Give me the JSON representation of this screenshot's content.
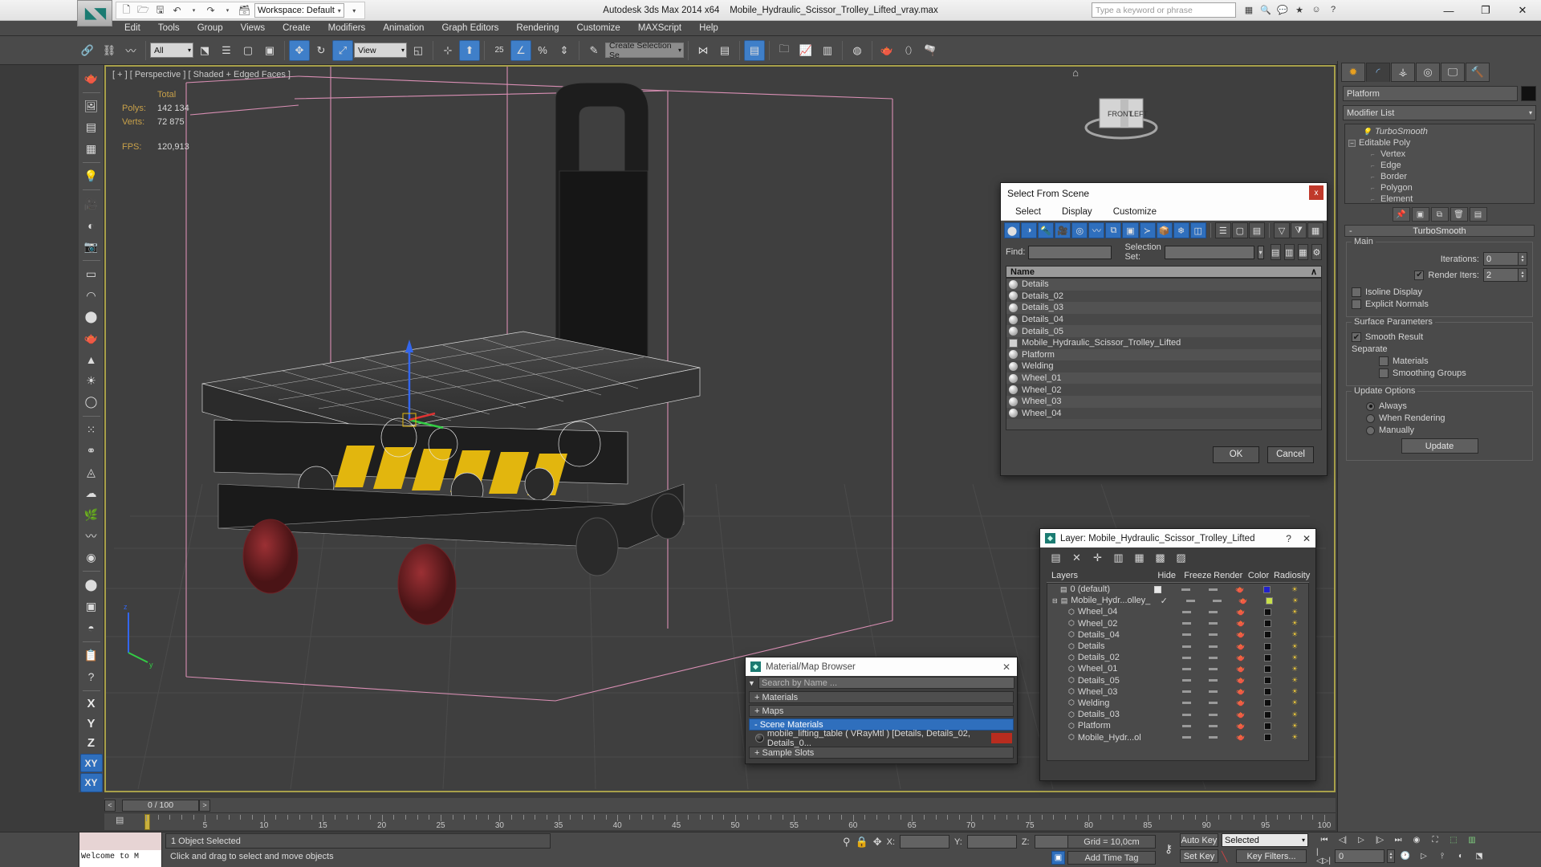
{
  "app": {
    "title_product": "Autodesk 3ds Max  2014 x64",
    "title_file": "Mobile_Hydraulic_Scissor_Trolley_Lifted_vray.max",
    "workspace_label": "Workspace: Default",
    "search_placeholder": "Type a keyword or phrase",
    "logo_glyph": "◆"
  },
  "menu": {
    "items": [
      "Edit",
      "Tools",
      "Group",
      "Views",
      "Create",
      "Modifiers",
      "Animation",
      "Graph Editors",
      "Rendering",
      "Customize",
      "MAXScript",
      "Help"
    ]
  },
  "quick_access": {
    "icons": [
      "new-file-icon",
      "open-file-icon",
      "save-icon",
      "undo-icon",
      "redo-icon",
      "set-project-icon"
    ]
  },
  "toolbar": {
    "selection_filter": "All",
    "reference_coord": "View",
    "named_selection_set": "Create Selection Se",
    "angle_snap_value": "25",
    "icons": [
      "select-link-icon",
      "unlink-icon",
      "bind-space-warp-icon",
      "select-object-icon",
      "select-by-name-icon",
      "rect-select-region-icon",
      "window-crossing-icon",
      "select-move-icon",
      "select-rotate-icon",
      "select-scale-icon",
      "use-pivot-center-icon",
      "align-icon",
      "snaps-toggle-icon",
      "angle-snap-icon",
      "percent-snap-icon",
      "spinner-snap-icon",
      "edit-named-selection-icon",
      "mirror-icon",
      "align-tool-icon",
      "layer-manager-icon",
      "curve-editor-icon",
      "schematic-view-icon",
      "material-editor-icon",
      "render-setup-icon",
      "render-frame-icon",
      "render-production-icon"
    ]
  },
  "viewport": {
    "label": "[ + ] [ Perspective ] [ Shaded + Edged Faces ]",
    "stats": {
      "header": "Total",
      "rows": [
        {
          "label": "Polys:",
          "value": "142 134"
        },
        {
          "label": "Verts:",
          "value": "72 875"
        },
        {
          "label": "FPS:",
          "value": "120,913"
        }
      ]
    },
    "viewcube_faces": [
      "FRONT",
      "LEFT"
    ]
  },
  "left_toolbar": {
    "icons": [
      "teapot-tool-icon",
      "render-preview-icon",
      "list-view-icon",
      "spreadsheet-icon",
      "light-lister-icon",
      "camera-icon",
      "shading-icon",
      "video-camera-icon",
      "plane-primitive-icon",
      "dome-primitive-icon",
      "sphere-primitive-icon",
      "teapot-primitive-icon",
      "cone-primitive-icon",
      "sun-light-icon",
      "sphere-light-icon",
      "particles-icon",
      "molecule-icon",
      "mesh-icon",
      "cloud-icon",
      "grass-icon",
      "hair-fur-icon",
      "ornatrix-icon",
      "sphere-material-icon",
      "map-browser-icon",
      "selection-material-icon",
      "asset-tracking-icon",
      "help-icon"
    ],
    "axis_constraints": [
      "X",
      "Y",
      "Z",
      "XY",
      "XY"
    ]
  },
  "command_panel": {
    "tabs": [
      "create-tab",
      "modify-tab",
      "hierarchy-tab",
      "motion-tab",
      "display-tab",
      "utilities-tab"
    ],
    "object_name": "Platform",
    "object_color": "#121212",
    "modifier_list_label": "Modifier List",
    "stack": [
      {
        "label": "TurboSmooth",
        "type": "modifier"
      },
      {
        "label": "Editable Poly",
        "type": "base"
      },
      {
        "label": "Vertex",
        "type": "sub"
      },
      {
        "label": "Edge",
        "type": "sub"
      },
      {
        "label": "Border",
        "type": "sub"
      },
      {
        "label": "Polygon",
        "type": "sub"
      },
      {
        "label": "Element",
        "type": "sub"
      }
    ],
    "rollout": {
      "title": "TurboSmooth",
      "main_group": "Main",
      "iterations_label": "Iterations:",
      "iterations_value": "0",
      "render_iters_label": "Render Iters:",
      "render_iters_value": "2",
      "render_iters_checked": true,
      "isoline_label": "Isoline Display",
      "isoline_checked": false,
      "explicit_label": "Explicit Normals",
      "explicit_checked": false,
      "surface_group": "Surface Parameters",
      "smooth_result_label": "Smooth Result",
      "smooth_result_checked": true,
      "separate_label": "Separate",
      "materials_label": "Materials",
      "materials_checked": false,
      "smoothing_groups_label": "Smoothing Groups",
      "smoothing_groups_checked": false,
      "update_group": "Update Options",
      "update_modes": [
        "Always",
        "When Rendering",
        "Manually"
      ],
      "update_selected": "Always",
      "update_button": "Update"
    }
  },
  "select_from_scene": {
    "title": "Select From Scene",
    "close_label": "x",
    "menus": [
      "Select",
      "Display",
      "Customize"
    ],
    "find_label": "Find:",
    "find_value": "",
    "selection_set_label": "Selection Set:",
    "selection_set_value": "",
    "column_header": "Name",
    "sort_glyph": "∧",
    "objects": [
      {
        "name": "Details",
        "icon": "geometry-icon"
      },
      {
        "name": "Details_02",
        "icon": "geometry-icon"
      },
      {
        "name": "Details_03",
        "icon": "geometry-icon"
      },
      {
        "name": "Details_04",
        "icon": "geometry-icon"
      },
      {
        "name": "Details_05",
        "icon": "geometry-icon"
      },
      {
        "name": "Mobile_Hydraulic_Scissor_Trolley_Lifted",
        "icon": "group-icon"
      },
      {
        "name": "Platform",
        "icon": "geometry-icon"
      },
      {
        "name": "Welding",
        "icon": "geometry-icon"
      },
      {
        "name": "Wheel_01",
        "icon": "geometry-icon"
      },
      {
        "name": "Wheel_02",
        "icon": "geometry-icon"
      },
      {
        "name": "Wheel_03",
        "icon": "geometry-icon"
      },
      {
        "name": "Wheel_04",
        "icon": "geometry-icon"
      }
    ],
    "ok_label": "OK",
    "cancel_label": "Cancel"
  },
  "layer_dialog": {
    "title": "Layer: Mobile_Hydraulic_Scissor_Trolley_Lifted",
    "help_label": "?",
    "close_label": "✕",
    "toolbar_icons": [
      "create-new-layer-icon",
      "delete-layer-icon",
      "add-selection-icon",
      "select-objects-icon",
      "highlight-layer-icon",
      "set-current-layer-icon",
      "layer-properties-icon"
    ],
    "columns": [
      "Layers",
      "Hide",
      "Freeze",
      "Render",
      "Color",
      "Radiosity"
    ],
    "rows": [
      {
        "name": "0 (default)",
        "indent": 1,
        "icon": "layer-icon",
        "current": false,
        "box": true,
        "color": "#2222cc"
      },
      {
        "name": "Mobile_Hydr...olley_",
        "indent": 0,
        "icon": "layer-icon",
        "current": true,
        "box": false,
        "color": "#c8e04a"
      },
      {
        "name": "Wheel_04",
        "indent": 2,
        "icon": "object-icon",
        "color": "#0d0d0d"
      },
      {
        "name": "Wheel_02",
        "indent": 2,
        "icon": "object-icon",
        "color": "#0d0d0d"
      },
      {
        "name": "Details_04",
        "indent": 2,
        "icon": "object-icon",
        "color": "#0d0d0d"
      },
      {
        "name": "Details",
        "indent": 2,
        "icon": "object-icon",
        "color": "#0d0d0d"
      },
      {
        "name": "Details_02",
        "indent": 2,
        "icon": "object-icon",
        "color": "#0d0d0d"
      },
      {
        "name": "Wheel_01",
        "indent": 2,
        "icon": "object-icon",
        "color": "#0d0d0d"
      },
      {
        "name": "Details_05",
        "indent": 2,
        "icon": "object-icon",
        "color": "#0d0d0d"
      },
      {
        "name": "Wheel_03",
        "indent": 2,
        "icon": "object-icon",
        "color": "#0d0d0d"
      },
      {
        "name": "Welding",
        "indent": 2,
        "icon": "object-icon",
        "color": "#0d0d0d"
      },
      {
        "name": "Details_03",
        "indent": 2,
        "icon": "object-icon",
        "color": "#0d0d0d"
      },
      {
        "name": "Platform",
        "indent": 2,
        "icon": "object-icon",
        "color": "#0d0d0d"
      },
      {
        "name": "Mobile_Hydr...ol",
        "indent": 2,
        "icon": "object-icon",
        "color": "#0d0d0d"
      }
    ]
  },
  "material_browser": {
    "title": "Material/Map Browser",
    "close_label": "✕",
    "search_placeholder": "Search by Name ...",
    "groups": [
      {
        "label": "+ Materials",
        "selected": false
      },
      {
        "label": "+ Maps",
        "selected": false
      },
      {
        "label": "- Scene Materials",
        "selected": true
      }
    ],
    "scene_material": "mobile_lifting_table ( VRayMtl ) [Details, Details_02, Details_0...",
    "sample_slots_label": "+ Sample Slots"
  },
  "timeline": {
    "frame_display": "0 / 100",
    "prev_glyph": "<",
    "next_glyph": ">",
    "ticks": [
      "5",
      "10",
      "15",
      "20",
      "25",
      "30",
      "35",
      "40",
      "45",
      "50",
      "55",
      "60",
      "65",
      "70",
      "75",
      "80",
      "85",
      "90",
      "95",
      "100"
    ]
  },
  "status_bar": {
    "maxlistener_text": "Welcome to M",
    "prompt_selection": "1 Object Selected",
    "prompt_hint": "Click and drag to select and move objects",
    "coords": {
      "x_label": "X:",
      "x_value": "",
      "y_label": "Y:",
      "y_value": "",
      "z_label": "Z:",
      "z_value": ""
    },
    "grid_label": "Grid = 10,0cm",
    "time_tag_label": "Add Time Tag",
    "auto_key_label": "Auto Key",
    "set_key_label": "Set Key",
    "key_mode_value": "Selected",
    "key_filters_label": "Key Filters...",
    "key_frame_value": "0"
  }
}
